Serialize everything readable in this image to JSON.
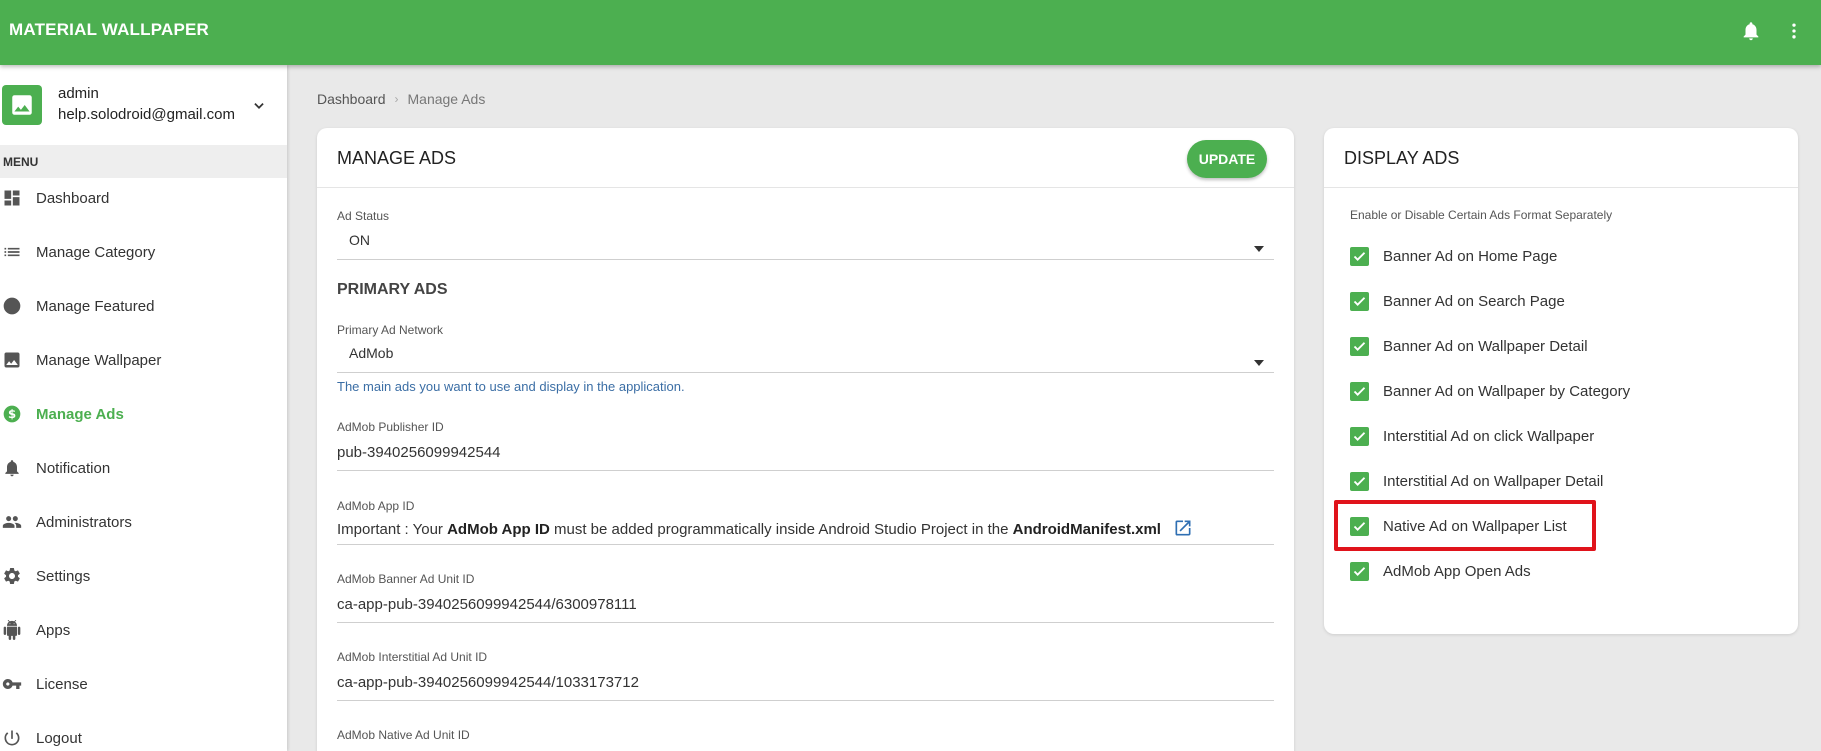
{
  "app": {
    "title": "MATERIAL WALLPAPER"
  },
  "topbar": {
    "icons": [
      "bell-icon",
      "more-vertical-icon"
    ]
  },
  "user": {
    "name": "admin",
    "email": "help.solodroid@gmail.com"
  },
  "sidebar": {
    "menu_header": "MENU",
    "items": [
      {
        "label": "Dashboard",
        "icon": "dashboard-icon"
      },
      {
        "label": "Manage Category",
        "icon": "list-icon"
      },
      {
        "label": "Manage Featured",
        "icon": "circle-icon"
      },
      {
        "label": "Manage Wallpaper",
        "icon": "image-icon"
      },
      {
        "label": "Manage Ads",
        "icon": "dollar-icon",
        "active": true
      },
      {
        "label": "Notification",
        "icon": "bell-icon"
      },
      {
        "label": "Administrators",
        "icon": "people-icon"
      },
      {
        "label": "Settings",
        "icon": "gear-icon"
      },
      {
        "label": "Apps",
        "icon": "android-icon"
      },
      {
        "label": "License",
        "icon": "key-icon"
      },
      {
        "label": "Logout",
        "icon": "power-icon"
      }
    ]
  },
  "breadcrumb": {
    "root": "Dashboard",
    "current": "Manage Ads"
  },
  "manage_ads": {
    "title": "MANAGE ADS",
    "update_label": "UPDATE",
    "ad_status": {
      "label": "Ad Status",
      "value": "ON"
    },
    "primary_section": "PRIMARY ADS",
    "primary_network": {
      "label": "Primary Ad Network",
      "value": "AdMob",
      "hint": "The main ads you want to use and display in the application."
    },
    "publisher_id": {
      "label": "AdMob Publisher ID",
      "value": "pub-3940256099942544"
    },
    "app_id": {
      "label": "AdMob App ID",
      "text_1": "Important : Your ",
      "bold_1": "AdMob App ID",
      "text_2": " must be added programmatically inside Android Studio Project in the ",
      "bold_2": "AndroidManifest.xml"
    },
    "banner_unit": {
      "label": "AdMob Banner Ad Unit ID",
      "value": "ca-app-pub-3940256099942544/6300978111"
    },
    "interstitial_unit": {
      "label": "AdMob Interstitial Ad Unit ID",
      "value": "ca-app-pub-3940256099942544/1033173712"
    },
    "native_unit": {
      "label": "AdMob Native Ad Unit ID"
    }
  },
  "display_ads": {
    "title": "DISPLAY ADS",
    "caption": "Enable or Disable Certain Ads Format Separately",
    "options": [
      {
        "label": "Banner Ad on Home Page",
        "checked": true
      },
      {
        "label": "Banner Ad on Search Page",
        "checked": true
      },
      {
        "label": "Banner Ad on Wallpaper Detail",
        "checked": true
      },
      {
        "label": "Banner Ad on Wallpaper by Category",
        "checked": true
      },
      {
        "label": "Interstitial Ad on click Wallpaper",
        "checked": true
      },
      {
        "label": "Interstitial Ad on Wallpaper Detail",
        "checked": true
      },
      {
        "label": "Native Ad on Wallpaper List",
        "checked": true,
        "highlighted": true
      },
      {
        "label": "AdMob App Open Ads",
        "checked": true
      }
    ]
  },
  "colors": {
    "primary": "#4caf50",
    "highlight": "#e0131b",
    "hint": "#3b6ea5"
  }
}
